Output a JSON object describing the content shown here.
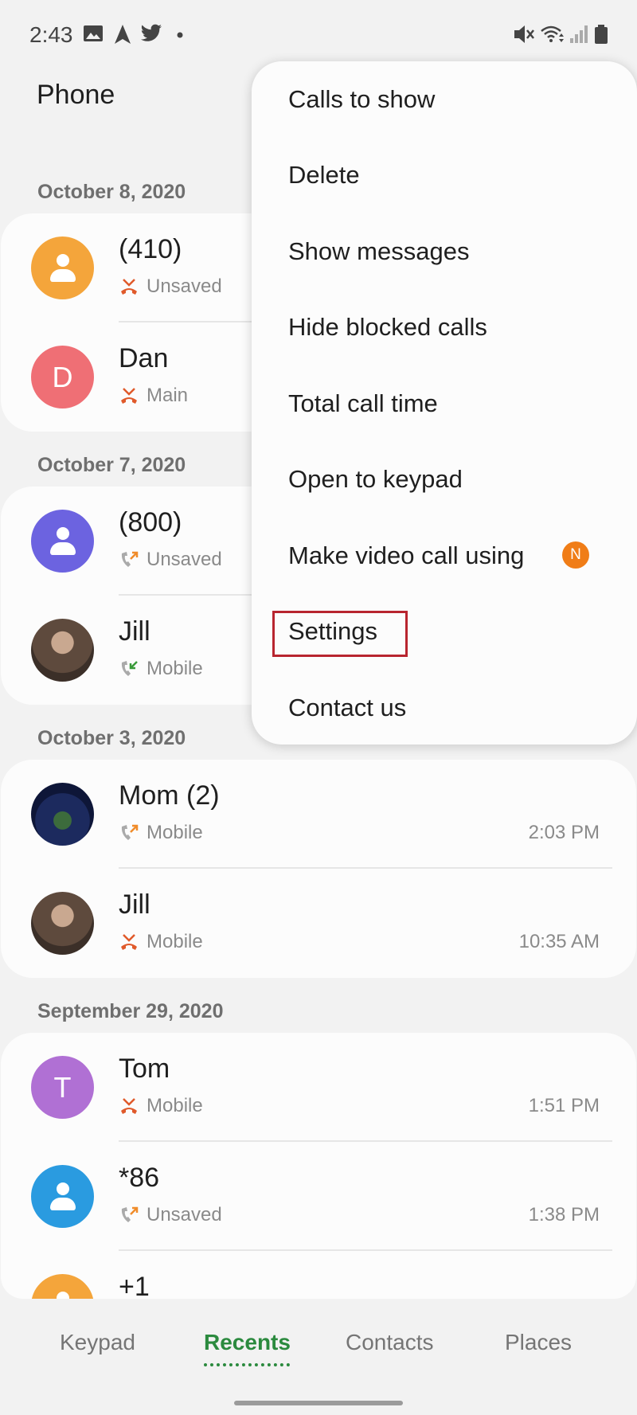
{
  "status_bar": {
    "time": "2:43"
  },
  "app": {
    "title": "Phone"
  },
  "sections": [
    {
      "date": "October 8, 2020",
      "rows": [
        {
          "name": "(410)",
          "sub": "Unsaved",
          "time": "",
          "call": "missed",
          "avatar": "default",
          "color": "#f4a53b"
        },
        {
          "name": "Dan",
          "sub": "Main",
          "time": "",
          "call": "missed",
          "avatar": "letter",
          "letter": "D",
          "color": "#ef6f75"
        }
      ]
    },
    {
      "date": "October 7, 2020",
      "rows": [
        {
          "name": "(800)",
          "sub": "Unsaved",
          "time": "",
          "call": "outgoing",
          "avatar": "default",
          "color": "#6c63e0"
        },
        {
          "name": "Jill",
          "sub": "Mobile",
          "time": "",
          "call": "incoming",
          "avatar": "photo",
          "color": "#5e4a3d"
        }
      ]
    },
    {
      "date": "October 3, 2020",
      "rows": [
        {
          "name": "Mom (2)",
          "sub": "Mobile",
          "time": "2:03 PM",
          "call": "outgoing",
          "avatar": "photo-night",
          "color": "#1c2a5e"
        },
        {
          "name": "Jill",
          "sub": "Mobile",
          "time": "10:35 AM",
          "call": "missed",
          "avatar": "photo",
          "color": "#5e4a3d"
        }
      ]
    },
    {
      "date": "September 29, 2020",
      "rows": [
        {
          "name": "Tom",
          "sub": "Mobile",
          "time": "1:51 PM",
          "call": "missed",
          "avatar": "letter",
          "letter": "T",
          "color": "#b070d4"
        },
        {
          "name": "*86",
          "sub": "Unsaved",
          "time": "1:38 PM",
          "call": "outgoing",
          "avatar": "default",
          "color": "#2a9be0"
        },
        {
          "name": "+1",
          "sub": "",
          "time": "",
          "call": "none",
          "avatar": "default",
          "color": "#f4a53b"
        }
      ]
    }
  ],
  "menu": {
    "items": [
      "Calls to show",
      "Delete",
      "Show messages",
      "Hide blocked calls",
      "Total call time",
      "Open to keypad",
      "Make video call using",
      "Settings",
      "Contact us"
    ],
    "badge": "N"
  },
  "bottom_nav": {
    "tabs": [
      "Keypad",
      "Recents",
      "Contacts",
      "Places"
    ],
    "active": "Recents"
  },
  "colors": {
    "missed": "#e05a2b",
    "outgoing": "#f08c2a",
    "incoming": "#3a9a3a",
    "accent": "#2b8a3e",
    "highlight": "#b8252f"
  }
}
